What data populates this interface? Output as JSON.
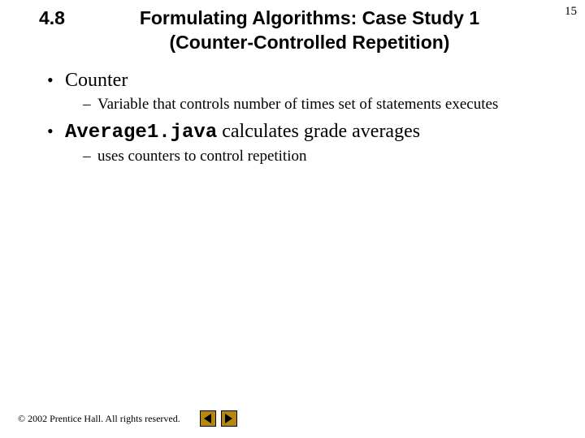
{
  "page_number": "15",
  "title": {
    "section_number": "4.8",
    "line1": "Formulating Algorithms: Case Study 1",
    "line2": "(Counter-Controlled Repetition)"
  },
  "bullets": [
    {
      "text": "Counter",
      "children": [
        {
          "text": "Variable that controls number of times set of statements executes"
        }
      ]
    },
    {
      "code": "Average1.java",
      "text_after": " calculates grade averages",
      "children": [
        {
          "text": "uses counters to control repetition"
        }
      ]
    }
  ],
  "footer": {
    "copyright": "© 2002 Prentice Hall. All rights reserved."
  }
}
